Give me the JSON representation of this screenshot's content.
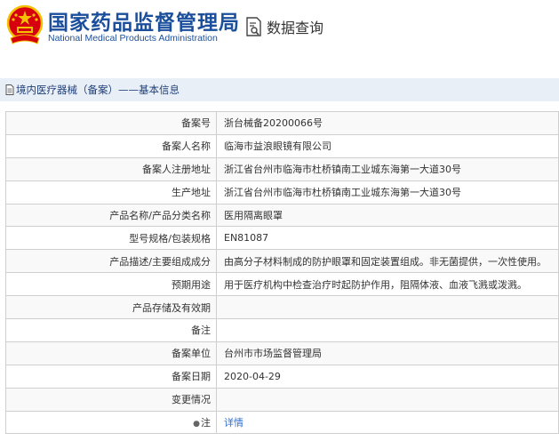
{
  "header": {
    "title_cn": "国家药品监督管理局",
    "title_en": "National Medical Products Administration",
    "emblem_icon": "national-emblem-icon",
    "query_icon": "data-search-icon",
    "query_label": "数据查询"
  },
  "breadcrumb": {
    "icon": "document-icon",
    "text": "境内医疗器械（备案）——基本信息"
  },
  "colors": {
    "brand_blue": "#1b4f9c",
    "link_blue": "#2f6fd0",
    "crumb_bg": "#e9eff7",
    "emblem_red": "#d7000f",
    "emblem_gold": "#f5c000"
  },
  "rows": [
    {
      "label": "备案号",
      "value": "浙台械备20200066号"
    },
    {
      "label": "备案人名称",
      "value": "临海市益浪眼镜有限公司"
    },
    {
      "label": "备案人注册地址",
      "value": "浙江省台州市临海市杜桥镇南工业城东海第一大道30号"
    },
    {
      "label": "生产地址",
      "value": "浙江省台州市临海市杜桥镇南工业城东海第一大道30号"
    },
    {
      "label": "产品名称/产品分类名称",
      "value": "医用隔离眼罩"
    },
    {
      "label": "型号规格/包装规格",
      "value": "EN81087"
    },
    {
      "label": "产品描述/主要组成成分",
      "value": "由高分子材料制成的防护眼罩和固定装置组成。非无菌提供，一次性使用。"
    },
    {
      "label": "预期用途",
      "value": "用于医疗机构中检查治疗时起防护作用，阻隔体液、血液飞溅或泼溅。"
    },
    {
      "label": "产品存储及有效期",
      "value": ""
    },
    {
      "label": "备注",
      "value": ""
    },
    {
      "label": "备案单位",
      "value": "台州市市场监督管理局"
    },
    {
      "label": "备案日期",
      "value": "2020-04-29"
    },
    {
      "label": "变更情况",
      "value": ""
    },
    {
      "label": "注",
      "value": "详情",
      "pin_icon": "pin-icon"
    }
  ]
}
